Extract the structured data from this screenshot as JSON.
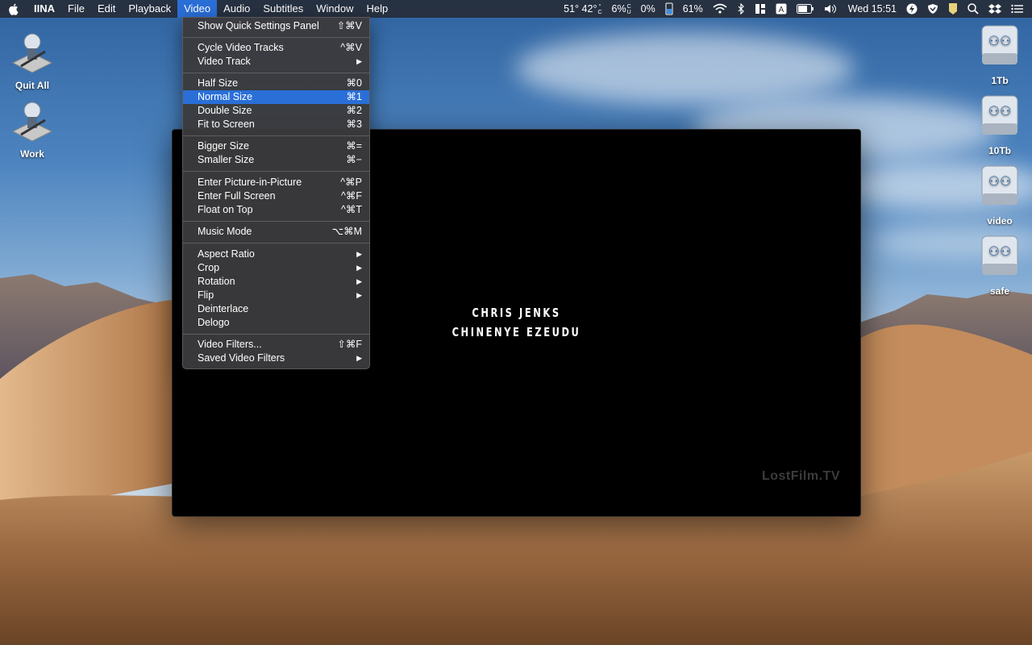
{
  "menubar": {
    "app": "IINA",
    "menus": [
      "File",
      "Edit",
      "Playback",
      "Video",
      "Audio",
      "Subtitles",
      "Window",
      "Help"
    ],
    "active_menu": "Video",
    "status": {
      "temp1": "51°",
      "temp2": "42°",
      "cpu": "6%",
      "gpu": "0%",
      "battery": "61%",
      "clock": "Wed 15:51"
    }
  },
  "video_menu": {
    "items": [
      {
        "label": "Show Quick Settings Panel",
        "shortcut": "⇧⌘V"
      },
      {
        "label": "Cycle Video Tracks",
        "shortcut": "^⌘V"
      },
      {
        "label": "Video Track",
        "shortcut": "▶"
      },
      {
        "label": "Half Size",
        "shortcut": "⌘0"
      },
      {
        "label": "Normal Size",
        "shortcut": "⌘1"
      },
      {
        "label": "Double Size",
        "shortcut": "⌘2"
      },
      {
        "label": "Fit to Screen",
        "shortcut": "⌘3"
      },
      {
        "label": "Bigger Size",
        "shortcut": "⌘="
      },
      {
        "label": "Smaller Size",
        "shortcut": "⌘−"
      },
      {
        "label": "Enter Picture-in-Picture",
        "shortcut": "^⌘P"
      },
      {
        "label": "Enter Full Screen",
        "shortcut": "^⌘F"
      },
      {
        "label": "Float on Top",
        "shortcut": "^⌘T"
      },
      {
        "label": "Music Mode",
        "shortcut": "⌥⌘M"
      },
      {
        "label": "Aspect Ratio",
        "shortcut": "▶"
      },
      {
        "label": "Crop",
        "shortcut": "▶"
      },
      {
        "label": "Rotation",
        "shortcut": "▶"
      },
      {
        "label": "Flip",
        "shortcut": "▶"
      },
      {
        "label": "Deinterlace",
        "shortcut": ""
      },
      {
        "label": "Delogo",
        "shortcut": ""
      },
      {
        "label": "Video Filters...",
        "shortcut": "⇧⌘F"
      },
      {
        "label": "Saved Video Filters",
        "shortcut": "▶"
      }
    ],
    "highlighted": "Normal Size"
  },
  "desktop_icons": {
    "left": [
      "Quit All",
      "Work"
    ],
    "right": [
      "1Tb",
      "10Tb",
      "video",
      "safe"
    ]
  },
  "player": {
    "credit_line1": "CHRIS JENKS",
    "credit_line2": "CHINENYE EZEUDU",
    "watermark": "LostFilm.TV"
  },
  "colors": {
    "menu_highlight": "#2a6fd8",
    "menubar_bg": "#262c38",
    "menu_bg": "#3a3a3c"
  }
}
